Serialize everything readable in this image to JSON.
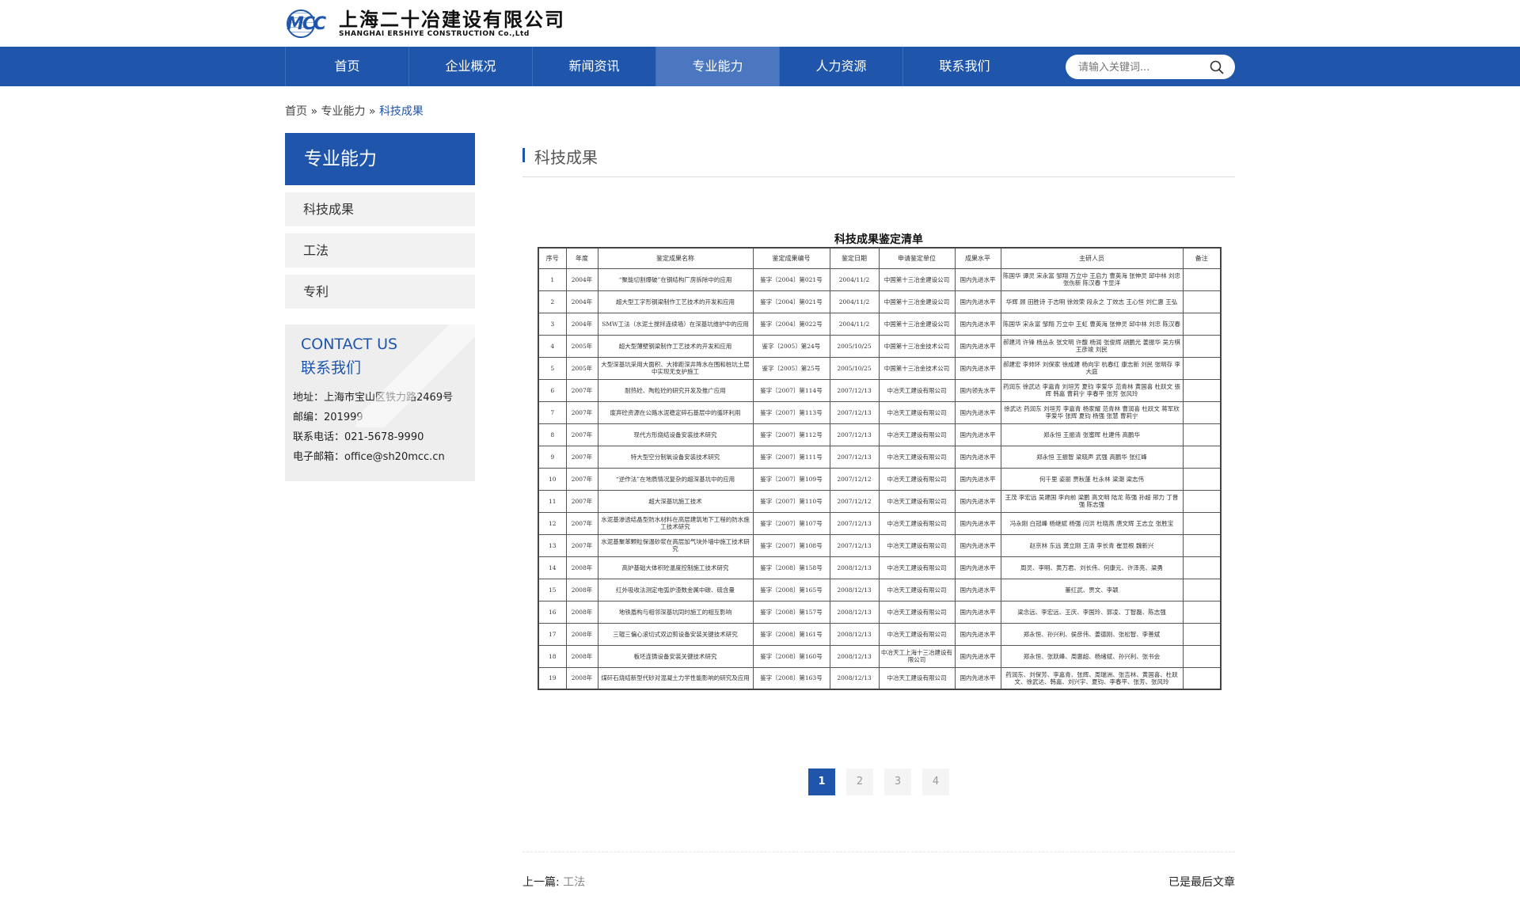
{
  "header": {
    "logo_mark": "MCC",
    "logo_cn": "上海二十冶建设有限公司",
    "logo_en": "SHANGHAI ERSHIYE CONSTRUCTION Co.,Ltd"
  },
  "nav": {
    "items": [
      "首页",
      "企业概况",
      "新闻资讯",
      "专业能力",
      "人力资源",
      "联系我们"
    ],
    "active": "专业能力",
    "search_placeholder": "请输入关键词..."
  },
  "breadcrumb": {
    "home": "首页",
    "sep": " » ",
    "section": "专业能力",
    "current": "科技成果"
  },
  "sidebar": {
    "title": "专业能力",
    "items": [
      "科技成果",
      "工法",
      "专利"
    ],
    "contact": {
      "en": "CONTACT US",
      "cn": "联系我们",
      "address": "地址：上海市宝山区铁力路2469号",
      "postcode": "邮编：201999",
      "phone": "联系电话：021-5678-9990",
      "email": "电子邮箱：office@sh20mcc.cn"
    }
  },
  "main": {
    "title": "科技成果",
    "table": {
      "caption": "科技成果鉴定清单",
      "headers": [
        "序号",
        "年度",
        "鉴定成果名称",
        "鉴定成果编号",
        "鉴定日期",
        "申请鉴定单位",
        "成果水平",
        "主研人员",
        "备注"
      ],
      "rows": [
        [
          "1",
          "2004年",
          "“聚能切割爆破”在钢结构厂房拆除中的应用",
          "鉴字〔2004〕第021号",
          "2004/11/2",
          "中国第十三冶金建设公司",
          "国内先进水平",
          "陈国华 谭灵 宋永富 邹翔 万立中 王启力 曹英海 张伸灵 邱中林 刘忠 张伤新 陈汉春 卞显洋",
          ""
        ],
        [
          "2",
          "2004年",
          "超大型工字形钢梁制作工艺技术的开发和应用",
          "鉴字〔2004〕第021号",
          "2004/11/2",
          "中国第十三冶金建设公司",
          "国内先进水平",
          "华辉 顾 田胜诗 于志明 徐效荣 段永之 丁效志 王心恒 刘仁惠 王弘",
          ""
        ],
        [
          "3",
          "2004年",
          "SMW工法（水泥土搅拌连续墙）在深基坑维护中的应用",
          "鉴字〔2004〕第022号",
          "2004/11/2",
          "中国第十三冶金建设公司",
          "国内先进水平",
          "陈国华 宋永富 邹翔 万立中 王虹 曹英海 张伸灵 邱中林 刘忠 陈汉春",
          ""
        ],
        [
          "4",
          "2005年",
          "超大型薄壁钢梁制作工艺技术的开发和应用",
          "鉴字〔2005〕第24号",
          "2005/10/25",
          "中国第十三冶金技术公司",
          "国内先进水平",
          "郝建鸿 许锋 杨丛永 张文明 许馥 杨润 张俊辉 胡鹏光 姜振华 吴方棋 王彦竣 刘民",
          ""
        ],
        [
          "5",
          "2005年",
          "大型深基坑采用大面积、大排距深井降水在围和桩坑土层中实现无支护施工",
          "鉴字〔2005〕第25号",
          "2005/10/25",
          "中国第十三冶金技术公司",
          "国内先进水平",
          "郝建宏 李帅环 刘保家 徐成建 杨向宇 杭春红 康志新 刘民 张明存 李大庭",
          ""
        ],
        [
          "6",
          "2007年",
          "耐热砼、陶粒砼的研究开发及推广应用",
          "鉴字〔2007〕第114号",
          "2007/12/13",
          "中冶天工建设有限公司",
          "国内领先水平",
          "药润东 徐武达 李嘉青 刘垣芳 夏钧 李爱华 范青林 黄国喜 杜跃文 張辉 韩嘉 曹莉宁 李春平 张芳 张风玲",
          ""
        ],
        [
          "7",
          "2007年",
          "废弃砼资源在公路水泥稳定碎石基层中的循环利用",
          "鉴字〔2007〕第113号",
          "2007/12/13",
          "中冶天工建设有限公司",
          "国内先进水平",
          "徐武达 药润东 刘垣芳 李嘉青 杨家耀 范青林 曹润喜 杜跃文 蒋军欣 李爱华 张辉 夏钧 杨强 张慧 曹莉宁",
          ""
        ],
        [
          "8",
          "2007年",
          "现代方形烧结设备安装技术研究",
          "鉴字〔2007〕第112号",
          "2007/12/13",
          "中冶天工建设有限公司",
          "国内先进水平",
          "郑永恒 王振清 张蜜晖 杜建伟 高鹏华",
          ""
        ],
        [
          "9",
          "2007年",
          "特大型空分制氧设备安装技术研究",
          "鉴字〔2007〕第111号",
          "2007/12/13",
          "中冶天工建设有限公司",
          "国内先进水平",
          "郑永恒 王振智 梁晓声 武强 高鹏华 张红峰",
          ""
        ],
        [
          "10",
          "2007年",
          "“逆作法”在地质情况复杂的超深基坑中的应用",
          "鉴字〔2007〕第109号",
          "2007/12/12",
          "中冶天工建设有限公司",
          "国内先进水平",
          "何千里 姿丽 贾秋蓬 杜永林 梁潮 梁志伟",
          ""
        ],
        [
          "11",
          "2007年",
          "超大深基坑施工技术",
          "鉴字〔2007〕第110号",
          "2007/12/12",
          "中冶天工建设有限公司",
          "国内先进水平",
          "王茂 李宏远 吴建国 李向前 梁鹏 高文明 陆龙 陈强 孙超 邢力 丁晋强 陈志强",
          ""
        ],
        [
          "12",
          "2007年",
          "水泥基渗透结晶型防水材料在高层建筑地下工程的防水施工技术研究",
          "鉴字〔2007〕第107号",
          "2007/12/13",
          "中冶天工建设有限公司",
          "国内先进水平",
          "冯永刚 白冠峰 杨继斌 杨强 闫洪 杜晓燕 唐文辉 王志立 张胜宝",
          ""
        ],
        [
          "13",
          "2007年",
          "水泥基聚苯颗粒保温砂浆在高层加气块外墙中施工技术研究",
          "鉴字〔2007〕第108号",
          "2007/12/13",
          "中冶天工建设有限公司",
          "国内先进水平",
          "赵京林 东远 龚立刚 王清 李长青 崔显根 魏新兴",
          ""
        ],
        [
          "14",
          "2008年",
          "高炉基础大体积砼温度控制施工技术研究",
          "鉴字〔2008〕第158号",
          "2008/12/13",
          "中冶天工建设有限公司",
          "国内先进水平",
          "周灵、李明、黄万君、刘长伟、何康元、许泽亮、梁勇",
          ""
        ],
        [
          "15",
          "2008年",
          "红外吸收法测定电弧炉渣数金属中碳、硫含量",
          "鉴字〔2008〕第165号",
          "2008/12/13",
          "中冶天工建设有限公司",
          "国内先进水平",
          "董红武、贾文、李颖",
          ""
        ],
        [
          "16",
          "2008年",
          "地铁盾构与相邻深基坑同时施工的相互影响",
          "鉴字〔2008〕第157号",
          "2008/12/13",
          "中冶天工建设有限公司",
          "国内先进水平",
          "梁念远、李宏远、王庆、李国玲、郭凌、丁智磊、陈志强",
          ""
        ],
        [
          "17",
          "2008年",
          "三辊三偏心滚切式双边剪设备安装关键技术研究",
          "鉴字〔2008〕第161号",
          "2008/12/13",
          "中冶天工建设有限公司",
          "国内先进水平",
          "郑永恒、孙兴利、侯彦伟、姜德刚、张松智、李善斌",
          ""
        ],
        [
          "18",
          "2008年",
          "板坯连铸设备安装关键技术研究",
          "鉴字〔2008〕第160号",
          "2008/12/13",
          "中冶天工上海十三冶建设有限公司",
          "国内先进水平",
          "郑永恒、张跃峰、周惠超、杨绪斌、孙兴利、张书会",
          ""
        ],
        [
          "19",
          "2008年",
          "煤矸石烧结新型代砂对混凝土力学性能影响的研究及应用",
          "鉴字〔2008〕第163号",
          "2008/12/13",
          "中冶天工建设有限公司",
          "国内先进水平",
          "药润东、刘保芳、李嘉青、张辉、周瑞洲、张吉林、黄国喜、杜跃文、徐武达、韩嘉、刘兴宇、夏钧、李春平、张芳、张风玲",
          ""
        ]
      ]
    }
  },
  "pager": {
    "pages": [
      "1",
      "2",
      "3",
      "4"
    ],
    "active": "1"
  },
  "footer": {
    "prev_label": "上一篇:",
    "prev_link": "工法",
    "last_label": "已是最后文章"
  }
}
